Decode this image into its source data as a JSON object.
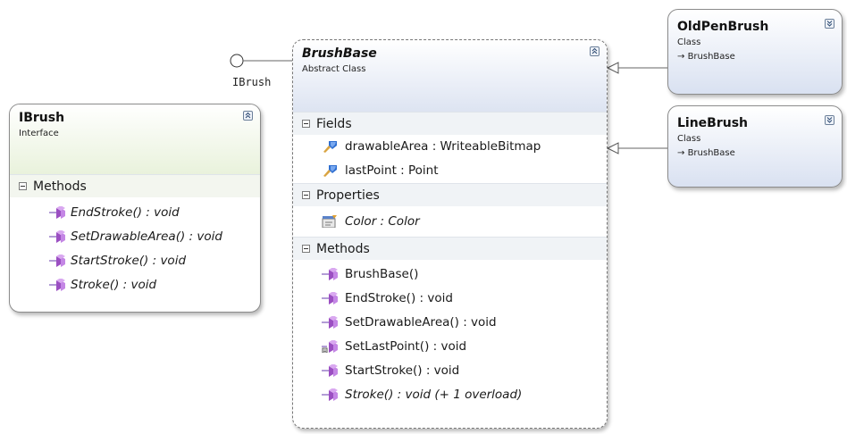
{
  "colors": {
    "header_gradient_top": "#ffffff",
    "iface_header_bottom": "#e9f2dc",
    "class_header_bottom": "#d9e1f1",
    "section_bg": "#f0f3f6",
    "border": "#8c8c8c"
  },
  "lollipop_label": "IBrush",
  "shapes": {
    "ibrush": {
      "title": "IBrush",
      "stereotype": "Interface",
      "sections": [
        {
          "label": "Methods",
          "members": [
            {
              "icon": "method-icon",
              "text": "EndStroke() : void"
            },
            {
              "icon": "method-icon",
              "text": "SetDrawableArea() : void"
            },
            {
              "icon": "method-icon",
              "text": "StartStroke() : void"
            },
            {
              "icon": "method-icon",
              "text": "Stroke() : void"
            }
          ]
        }
      ]
    },
    "brushbase": {
      "title": "BrushBase",
      "stereotype": "Abstract Class",
      "sections": [
        {
          "label": "Fields",
          "members": [
            {
              "icon": "field-icon",
              "text": "drawableArea : WriteableBitmap"
            },
            {
              "icon": "field-icon",
              "text": "lastPoint : Point"
            }
          ]
        },
        {
          "label": "Properties",
          "members": [
            {
              "icon": "property-icon",
              "text": "Color : Color"
            }
          ]
        },
        {
          "label": "Methods",
          "members": [
            {
              "icon": "method-icon",
              "text": "BrushBase()"
            },
            {
              "icon": "method-icon",
              "text": "EndStroke() : void"
            },
            {
              "icon": "method-icon",
              "text": "SetDrawableArea() : void"
            },
            {
              "icon": "protected-method-icon",
              "text": "SetLastPoint() : void"
            },
            {
              "icon": "method-icon",
              "text": "StartStroke() : void"
            },
            {
              "icon": "method-icon",
              "text": "Stroke() : void (+ 1 overload)"
            }
          ]
        }
      ]
    },
    "oldpenbrush": {
      "title": "OldPenBrush",
      "stereotype": "Class",
      "inherits": "BrushBase"
    },
    "linebrush": {
      "title": "LineBrush",
      "stereotype": "Class",
      "inherits": "BrushBase"
    }
  }
}
